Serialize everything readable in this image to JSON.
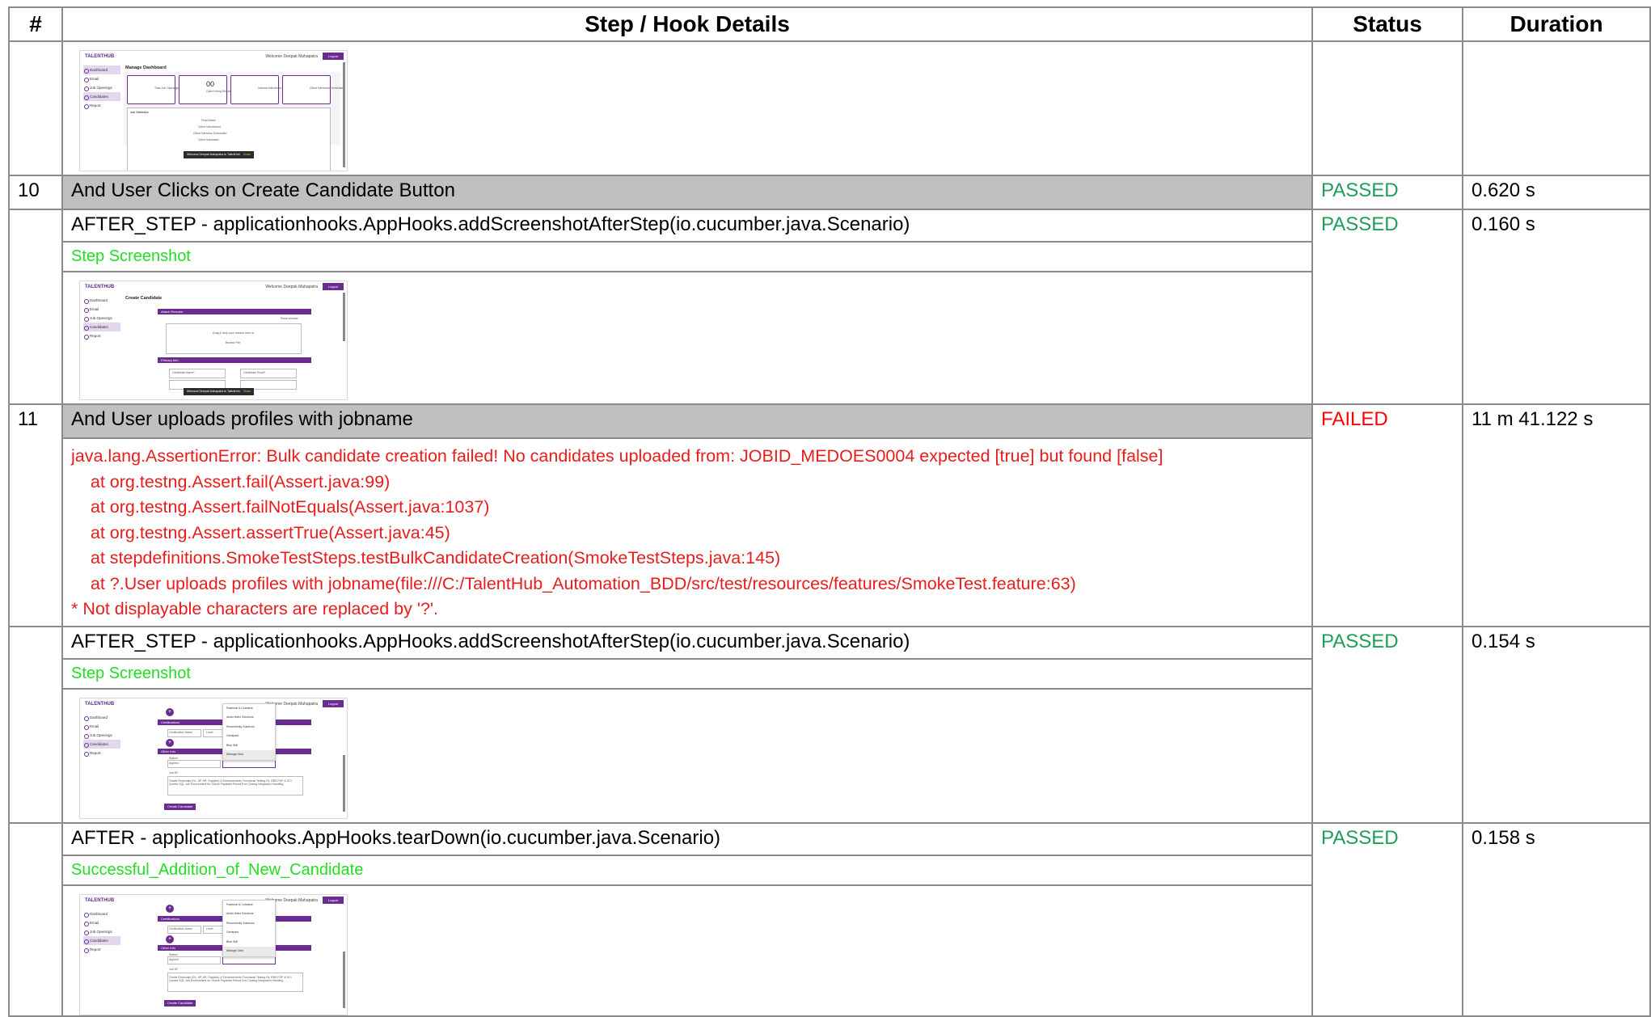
{
  "table": {
    "headers": [
      "#",
      "Step / Hook Details",
      "Status",
      "Duration"
    ]
  },
  "thumbs": {
    "brand": "TALENTHUB",
    "welcome": "Welcome Deepak Mahapatra",
    "logout": "Logout",
    "sidebar": [
      "Dashboard",
      "Email",
      "Job Openings",
      "Candidates",
      "Report"
    ],
    "dashboard_title": "Manage Dashboard",
    "dashboard_count": "00",
    "dashboard_cards": [
      "Total Job Openings",
      "Open Hiring Requisition",
      "Internal Interviews Scheduled",
      "Client Interviews Scheduled"
    ],
    "job_statistics": "Job Statistics",
    "stats_lines": [
      "Final Match",
      "Client Interviewed",
      "Client Interview Scheduled",
      "Client Interested"
    ],
    "toast": "Welcome Deepak Mahapatra to TalentHub",
    "toast_close": "Close",
    "create_title": "Create Candidate",
    "attach_resume": "Attach Resume",
    "parse_label": "Parse resume",
    "drag_drop": "Drag & drop your resume here or",
    "browse": "Browse File",
    "primary_info": "Primary Info",
    "candidate_name": "Candidate Name*",
    "candidate_email": "Candidate Email*",
    "certifications": "Certifications",
    "certification_name": "Certification Name",
    "certification_level": "Level",
    "other_info": "Other Info",
    "other_label": "Status*",
    "other_value": "Applied",
    "job_id": "Job ID*",
    "skills_text": "Oracle Financials (GL, AP, AR, Supplier) & Enhancements Functional Testing FA, EBS POF & SCI Quotes SQL Job Environment for Oracle Payables Period End Closing Integration Handling",
    "create_button": "Create Candidate",
    "dropdown": [
      "Fraternal & Cohesive",
      "Aristo Nebz Solutions",
      "Renovhesky Solutions",
      "Genepact",
      "Blue SMI",
      "Manage Jobs"
    ]
  },
  "rows": [
    {
      "num": "10",
      "step": "And User Clicks on Create Candidate Button",
      "status": "PASSED",
      "duration": "0.620 s"
    },
    {
      "hook": "AFTER_STEP - applicationhooks.AppHooks.addScreenshotAfterStep(io.cucumber.java.Scenario)",
      "status": "PASSED",
      "duration": "0.160 s",
      "label": "Step Screenshot"
    },
    {
      "num": "11",
      "step": "And User uploads profiles with jobname",
      "status": "FAILED",
      "duration": "11 m 41.122 s",
      "error": [
        "java.lang.AssertionError: Bulk candidate creation failed! No candidates uploaded from: JOBID_MEDOES0004 expected [true] but found [false]",
        "    at org.testng.Assert.fail(Assert.java:99)",
        "    at org.testng.Assert.failNotEquals(Assert.java:1037)",
        "    at org.testng.Assert.assertTrue(Assert.java:45)",
        "    at stepdefinitions.SmokeTestSteps.testBulkCandidateCreation(SmokeTestSteps.java:145)",
        "    at ?.User uploads profiles with jobname(file:///C:/TalentHub_Automation_BDD/src/test/resources/features/SmokeTest.feature:63)",
        "* Not displayable characters are replaced by '?'."
      ]
    },
    {
      "hook": "AFTER_STEP - applicationhooks.AppHooks.addScreenshotAfterStep(io.cucumber.java.Scenario)",
      "status": "PASSED",
      "duration": "0.154 s",
      "label": "Step Screenshot"
    },
    {
      "hook": "AFTER - applicationhooks.AppHooks.tearDown(io.cucumber.java.Scenario)",
      "status": "PASSED",
      "duration": "0.158 s",
      "label": "Successful_Addition_of_New_Candidate"
    }
  ],
  "colors": {
    "passed": "#1f9e5a",
    "failed": "#ff0000",
    "screenshot_label": "#22dd22",
    "step_bg": "#c0c0c0",
    "brand_purple": "#6a2c91"
  }
}
